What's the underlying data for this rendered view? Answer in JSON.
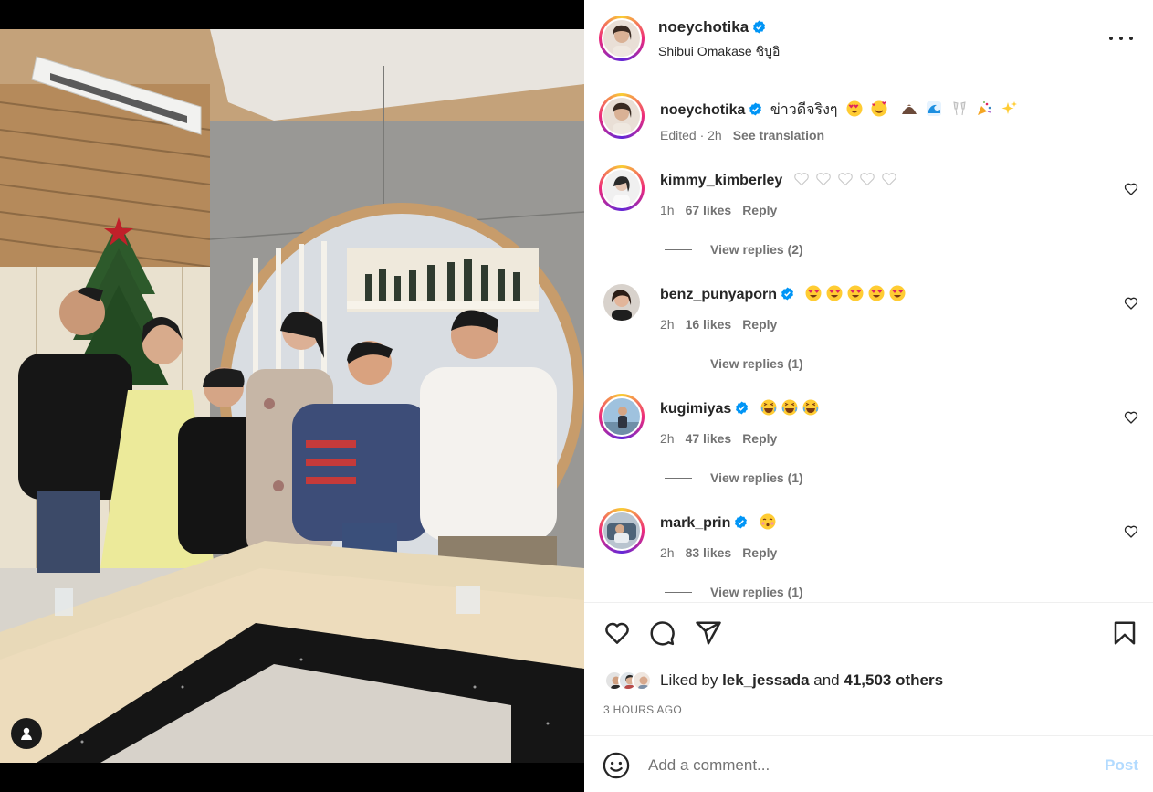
{
  "post": {
    "username": "noeychotika",
    "location": "Shibui Omakase ชิบูอิ",
    "caption_user": "noeychotika",
    "caption_text": "ข่าวดีจริงๆ",
    "caption_emojis": [
      "heart-eyes",
      "hug-hearts",
      "mountain",
      "wave",
      "clinking-glasses",
      "party-popper",
      "sparkles"
    ],
    "caption_meta": "Edited · 2h",
    "see_translation": "See translation"
  },
  "comments": [
    {
      "user": "kimmy_kimberley",
      "verified": false,
      "emojis": [
        "white-heart",
        "white-heart",
        "white-heart",
        "white-heart",
        "white-heart"
      ],
      "time": "1h",
      "likes": "67 likes",
      "reply": "Reply",
      "view_replies": "View replies (2)"
    },
    {
      "user": "benz_punyaporn",
      "verified": true,
      "emojis": [
        "heart-eyes",
        "heart-eyes",
        "heart-eyes",
        "heart-eyes",
        "heart-eyes"
      ],
      "time": "2h",
      "likes": "16 likes",
      "reply": "Reply",
      "view_replies": "View replies (1)"
    },
    {
      "user": "kugimiyas",
      "verified": true,
      "emojis": [
        "laughing",
        "laughing",
        "laughing"
      ],
      "time": "2h",
      "likes": "47 likes",
      "reply": "Reply",
      "view_replies": "View replies (1)"
    },
    {
      "user": "mark_prin",
      "verified": true,
      "emojis": [
        "kissing"
      ],
      "time": "2h",
      "likes": "83 likes",
      "reply": "Reply",
      "view_replies": "View replies (1)"
    }
  ],
  "likes": {
    "prefix": "Liked by",
    "user": "lek_jessada",
    "conj": "and",
    "count": "41,503 others"
  },
  "time_ago": "3 HOURS AGO",
  "add_comment": {
    "placeholder": "Add a comment...",
    "post_label": "Post"
  },
  "colors": {
    "accent": "#0095f6",
    "post_disabled": "#b3dbff",
    "meta_gray": "#737373"
  },
  "icons": [
    "heart-icon",
    "comment-icon",
    "share-icon",
    "bookmark-icon",
    "smile-icon",
    "more-icon",
    "verified-icon",
    "user-tag-icon"
  ]
}
